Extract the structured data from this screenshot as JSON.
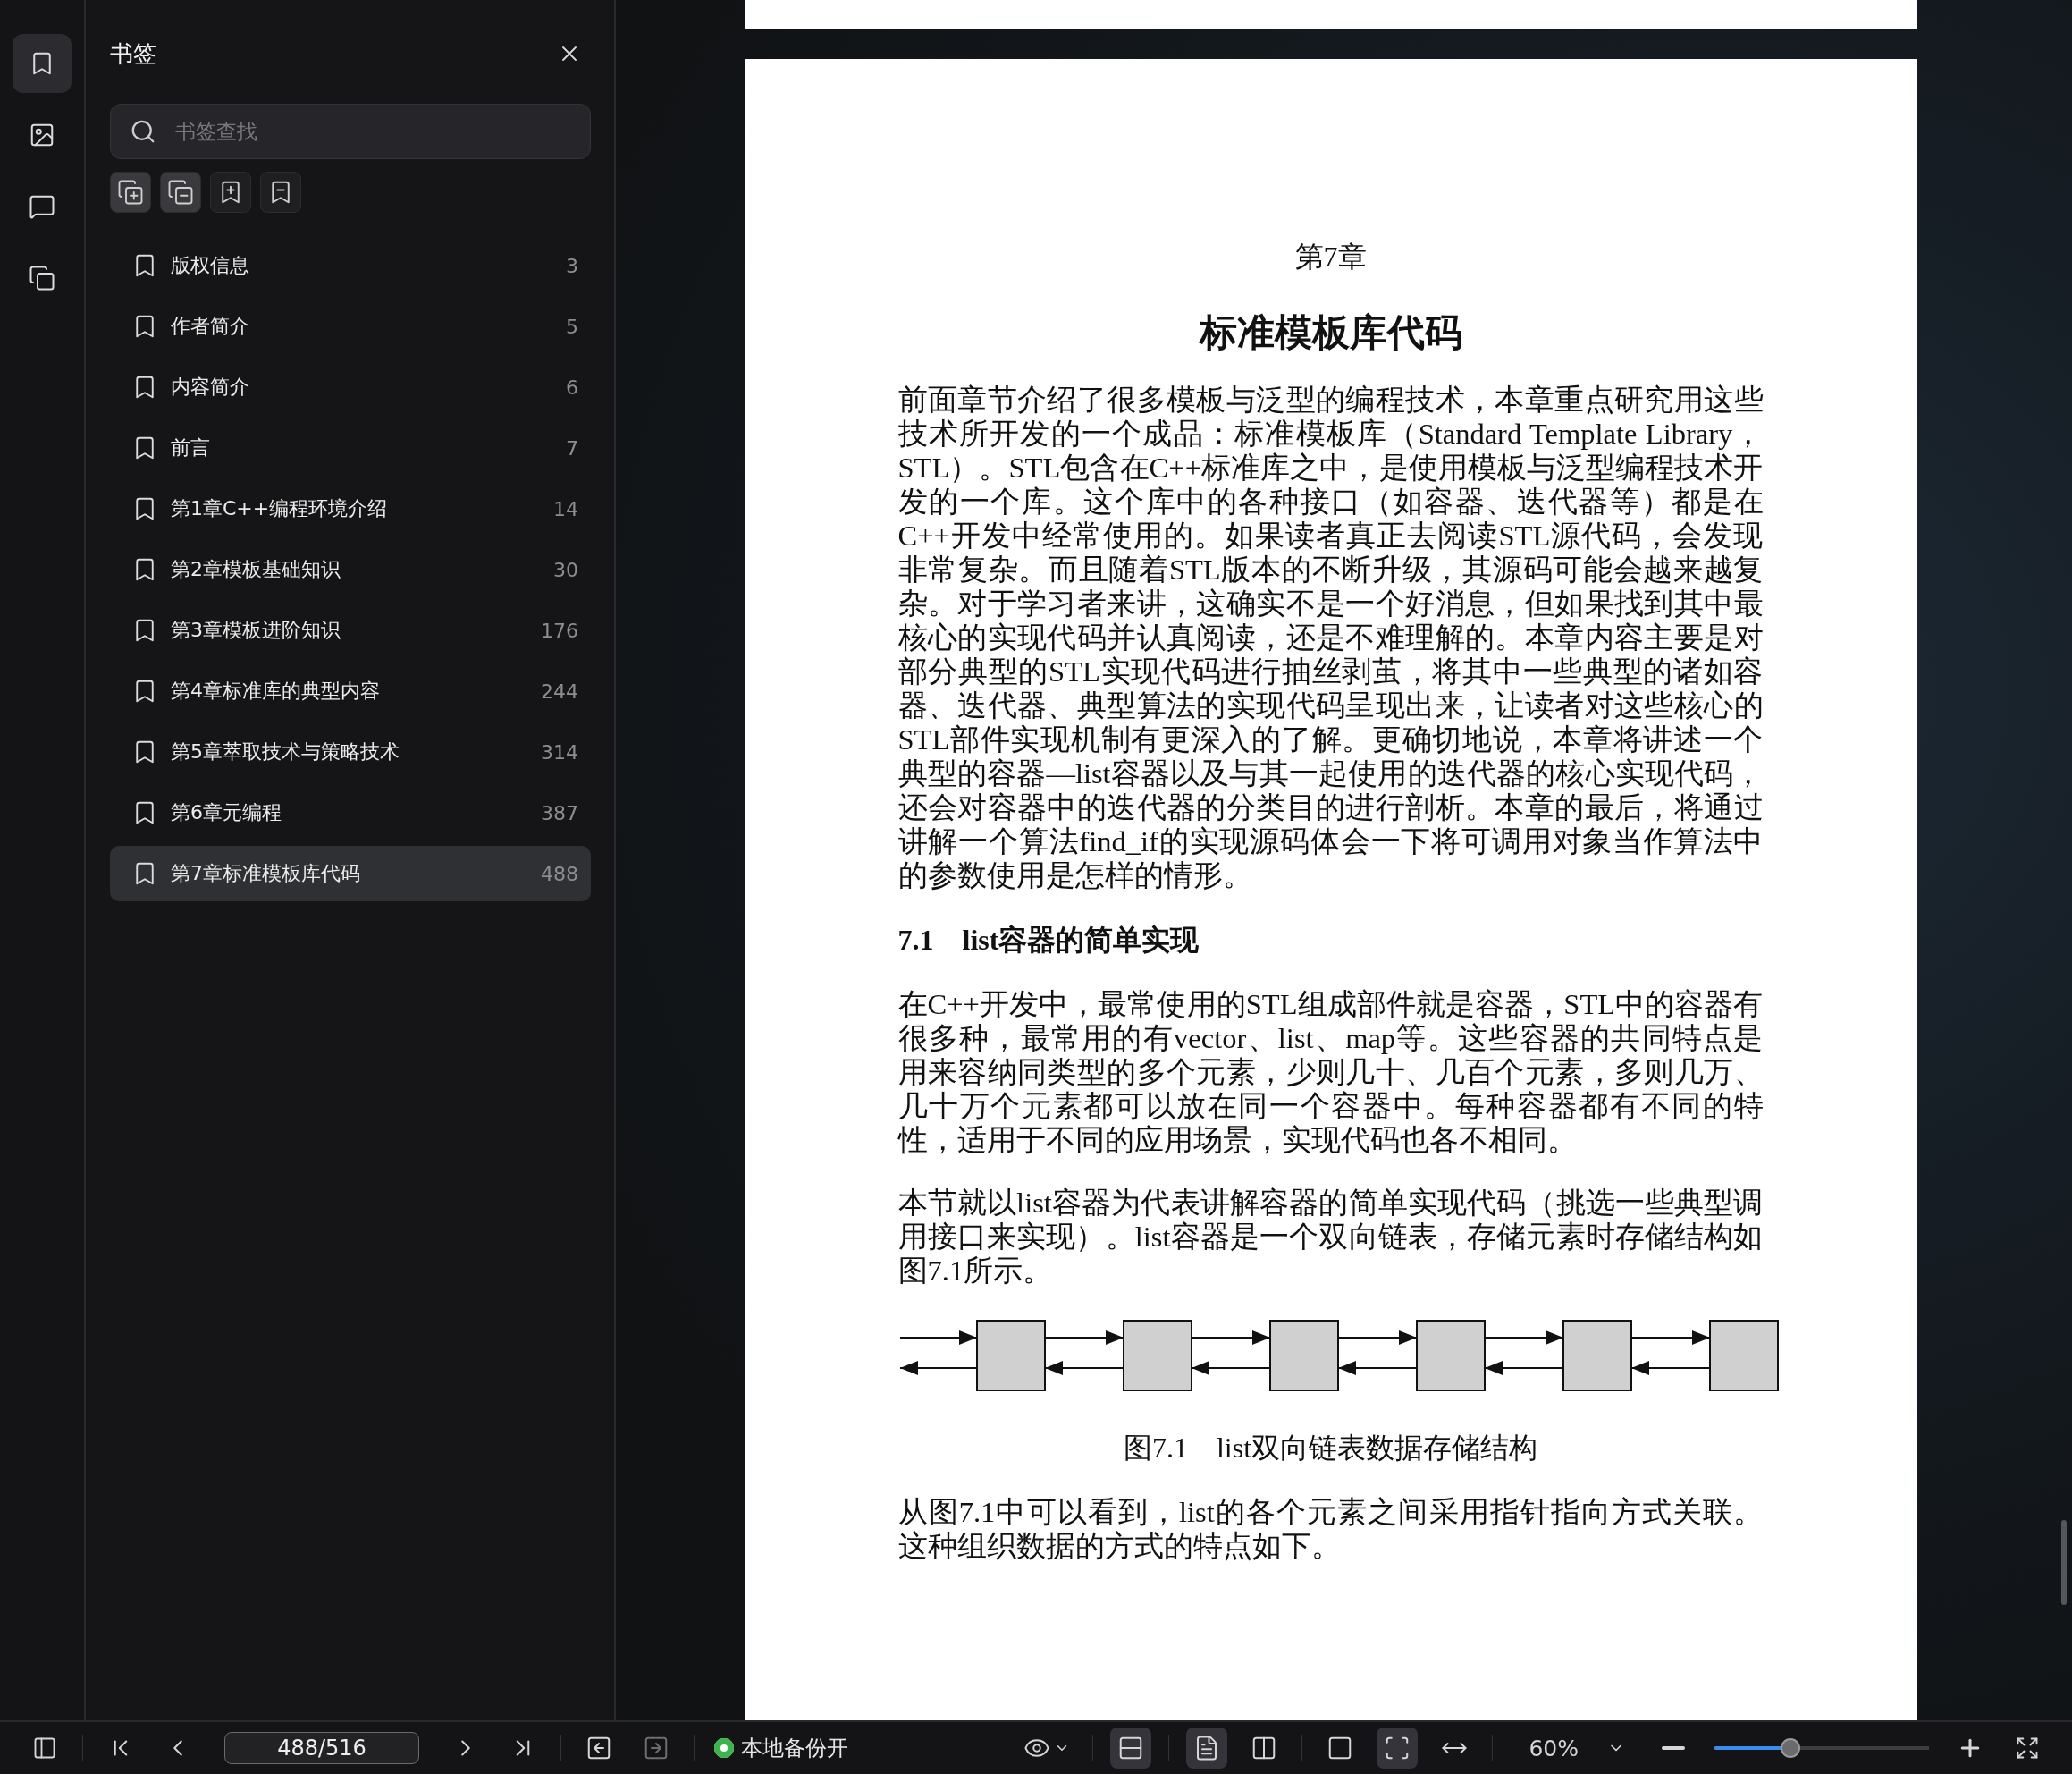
{
  "rail": [
    {
      "kind": "bookmark",
      "selected": true
    },
    {
      "kind": "image",
      "selected": false
    },
    {
      "kind": "comment",
      "selected": false
    },
    {
      "kind": "convert",
      "selected": false
    }
  ],
  "sidebar": {
    "title": "书签",
    "search": {
      "placeholder": "书签查找"
    },
    "tools": [
      {
        "kind": "expand",
        "on": true
      },
      {
        "kind": "collapse",
        "on": true
      },
      {
        "kind": "add",
        "on": false
      },
      {
        "kind": "remove",
        "on": false
      }
    ],
    "items": [
      {
        "label": "版权信息",
        "page": "3",
        "selected": false
      },
      {
        "label": "作者简介",
        "page": "5",
        "selected": false
      },
      {
        "label": "内容简介",
        "page": "6",
        "selected": false
      },
      {
        "label": "前言",
        "page": "7",
        "selected": false
      },
      {
        "label": "第1章C++编程环境介绍",
        "page": "14",
        "selected": false
      },
      {
        "label": "第2章模板基础知识",
        "page": "30",
        "selected": false
      },
      {
        "label": "第3章模板进阶知识",
        "page": "176",
        "selected": false
      },
      {
        "label": "第4章标准库的典型内容",
        "page": "244",
        "selected": false
      },
      {
        "label": "第5章萃取技术与策略技术",
        "page": "314",
        "selected": false
      },
      {
        "label": "第6章元编程",
        "page": "387",
        "selected": false
      },
      {
        "label": "第7章标准模板库代码",
        "page": "488",
        "selected": true
      }
    ]
  },
  "document": {
    "blocks": [
      {
        "kind": "chapter",
        "text": "第7章"
      },
      {
        "kind": "title",
        "text": "标准模板库代码"
      },
      {
        "kind": "para",
        "text": "前面章节介绍了很多模板与泛型的编程技术，本章重点研究用这些技术所开发的一个成品：标准模板库（Standard Template Library，STL）。STL包含在C++标准库之中，是使用模板与泛型编程技术开发的一个库。这个库中的各种接口（如容器、迭代器等）都是在C++开发中经常使用的。如果读者真正去阅读STL源代码，会发现非常复杂。而且随着STL版本的不断升级，其源码可能会越来越复杂。对于学习者来讲，这确实不是一个好消息，但如果找到其中最核心的实现代码并认真阅读，还是不难理解的。本章内容主要是对部分典型的STL实现代码进行抽丝剥茧，将其中一些典型的诸如容器、迭代器、典型算法的实现代码呈现出来，让读者对这些核心的STL部件实现机制有更深入的了解。更确切地说，本章将讲述一个典型的容器—list容器以及与其一起使用的迭代器的核心实现代码，还会对容器中的迭代器的分类目的进行剖析。本章的最后，将通过讲解一个算法find_if的实现源码体会一下将可调用对象当作算法中的参数使用是怎样的情形。"
      },
      {
        "kind": "heading",
        "text": "7.1　list容器的简单实现"
      },
      {
        "kind": "para",
        "text": "在C++开发中，最常使用的STL组成部件就是容器，STL中的容器有很多种，最常用的有vector、list、map等。这些容器的共同特点是用来容纳同类型的多个元素，少则几十、几百个元素，多则几万、几十万个元素都可以放在同一个容器中。每种容器都有不同的特性，适用于不同的应用场景，实现代码也各不相同。"
      },
      {
        "kind": "para",
        "text": "本节就以list容器为代表讲解容器的简单实现代码（挑选一些典型调用接口来实现）。list容器是一个双向链表，存储元素时存储结构如图7.1所示。"
      },
      {
        "kind": "figure"
      },
      {
        "kind": "caption",
        "text": "图7.1　list双向链表数据存储结构"
      },
      {
        "kind": "para",
        "text": "从图7.1中可以看到，list的各个元素之间采用指针指向方式关联。这种组织数据的方式的特点如下。"
      }
    ]
  },
  "status_bar": {
    "page_field": "488/516",
    "backup": {
      "label": "本地备份开",
      "on": true
    },
    "views": [
      {
        "kind": "fit-width",
        "on": true
      },
      {
        "kind": "single",
        "on": true
      },
      {
        "kind": "double",
        "on": false
      },
      {
        "kind": "actual",
        "on": false
      },
      {
        "kind": "fit-page",
        "on": true
      },
      {
        "kind": "rotate",
        "on": false
      }
    ],
    "zoom": {
      "value": "60%",
      "level": 0.34
    }
  }
}
